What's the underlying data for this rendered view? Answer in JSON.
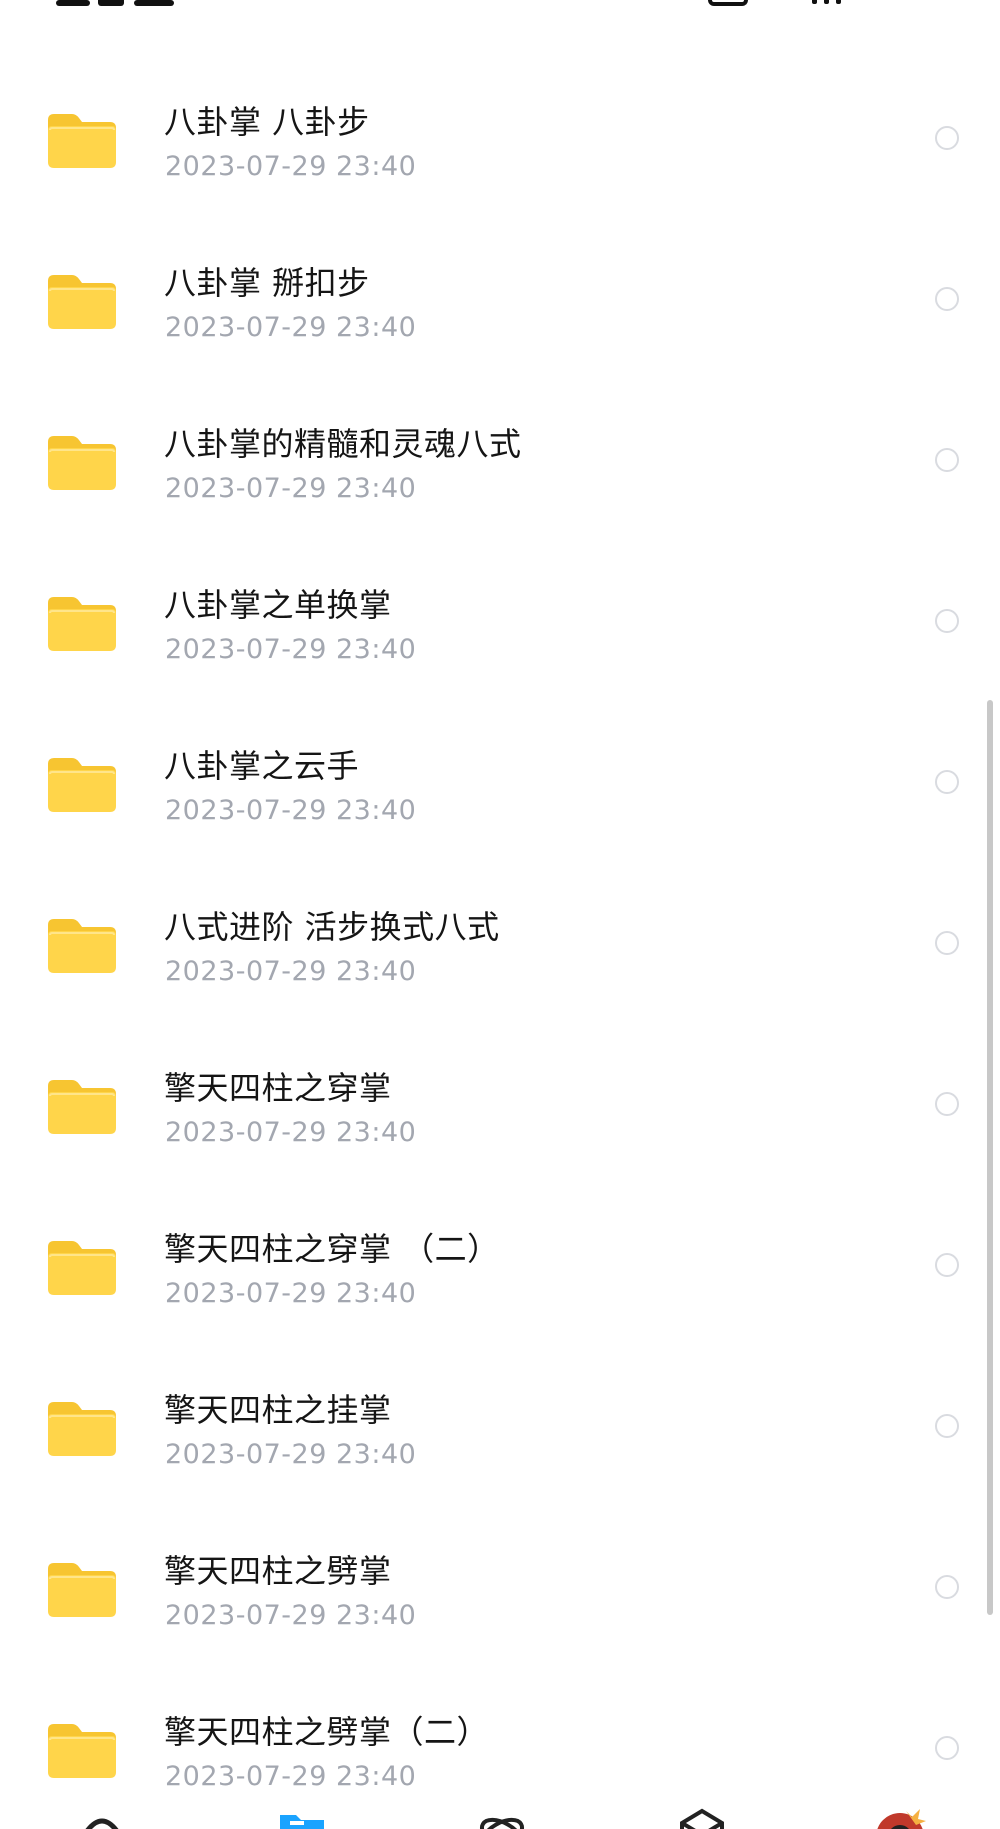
{
  "files": [
    {
      "name": "八卦掌 八卦步",
      "date": "2023-07-29 23:40"
    },
    {
      "name": "八卦掌 掰扣步",
      "date": "2023-07-29 23:40"
    },
    {
      "name": "八卦掌的精髓和灵魂八式",
      "date": "2023-07-29 23:40"
    },
    {
      "name": "八卦掌之单换掌",
      "date": "2023-07-29 23:40"
    },
    {
      "name": "八卦掌之云手",
      "date": "2023-07-29 23:40"
    },
    {
      "name": "八式进阶 活步换式八式",
      "date": "2023-07-29 23:40"
    },
    {
      "name": "擎天四柱之穿掌",
      "date": "2023-07-29 23:40"
    },
    {
      "name": "擎天四柱之穿掌 （二）",
      "date": "2023-07-29 23:40"
    },
    {
      "name": "擎天四柱之挂掌",
      "date": "2023-07-29 23:40"
    },
    {
      "name": "擎天四柱之劈掌",
      "date": "2023-07-29 23:40"
    },
    {
      "name": "擎天四柱之劈掌（二）",
      "date": "2023-07-29 23:40"
    }
  ],
  "icons": {
    "folder": "folder-icon",
    "select": "radio-circle-icon",
    "nav": [
      "home-icon",
      "files-icon",
      "discover-icon",
      "apps-icon",
      "avatar"
    ]
  },
  "colors": {
    "folder_front": "#FFD54A",
    "folder_back": "#F7C531",
    "date_text": "#A3A7B0",
    "check_border": "#D9DBE0",
    "nav_active": "#1AA3FF"
  }
}
